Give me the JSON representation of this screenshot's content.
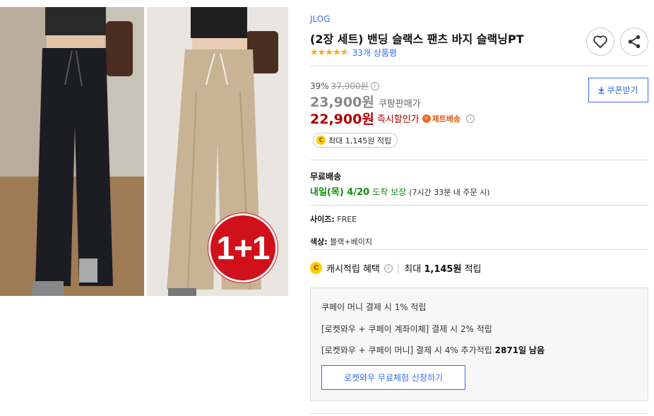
{
  "product": {
    "promo_badge": "1+1",
    "brand": "JLOG",
    "title": "(2장 세트) 밴딩 슬랙스 팬츠 바지 슬랙닝PT",
    "rating": 4.5,
    "review_count": "33개 상품평"
  },
  "actions": {
    "wish_icon": "heart-icon",
    "share_icon": "share-icon"
  },
  "price": {
    "discount_rate": "39%",
    "original_price": "37,900원",
    "sale_price": "23,900원",
    "sale_label": "쿠팡판매가",
    "instant_price": "22,900원",
    "instant_label": "즉시할인가",
    "jet_label": "제트배송",
    "coupon_button": "쿠폰받기",
    "cash_pill": "최대 1,145원 적립"
  },
  "shipping": {
    "title": "무료배송",
    "date": "내일(목) 4/20",
    "guarantee": "도착 보장",
    "cutoff": "(7시간 33분 내 주문 시)"
  },
  "options": {
    "size_label": "사이즈:",
    "size_value": "FREE",
    "color_label": "색상:",
    "color_value": "블랙+베이지"
  },
  "cash": {
    "label": "캐시적립 혜택",
    "max_prefix": "최대",
    "max_value": "1,145원",
    "max_suffix": "적립"
  },
  "benefits": {
    "line1": "쿠페이 머니 결제 시 1% 적립",
    "line2": "[로켓와우 + 쿠페이 계좌이체] 결제 시 2% 적립",
    "line3_text": "[로켓와우 + 쿠페이 머니] 결제 시 4% 추가적립",
    "line3_days": "2871일",
    "line3_suffix": "남음",
    "trial_button": "로켓와우 무료체험 신청하기"
  },
  "colors": {
    "link_blue": "#346aff",
    "price_red": "#ae0000",
    "ship_green": "#0f8f0f",
    "badge_red": "#d0101a",
    "star": "#f5a623"
  }
}
